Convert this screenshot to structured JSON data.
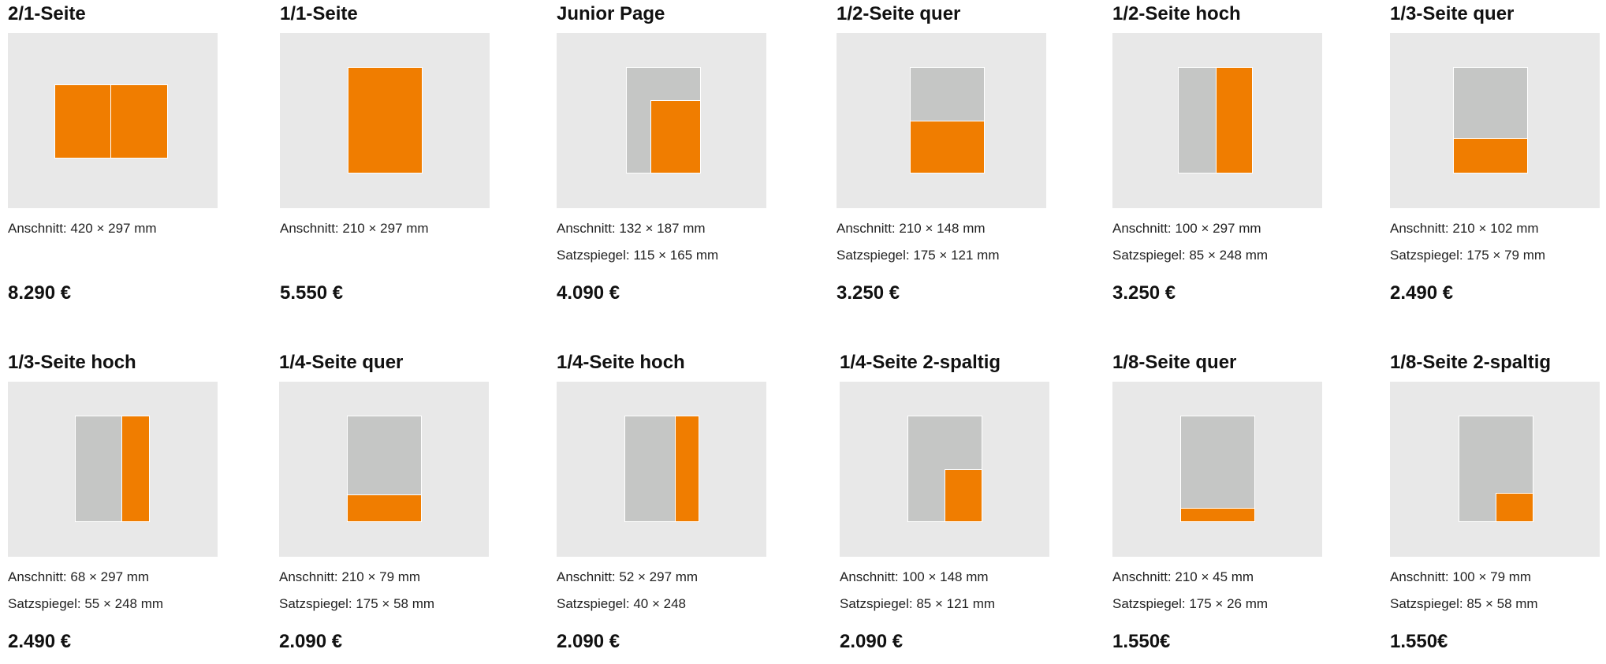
{
  "colors": {
    "ad": "#f07d00",
    "page": "#c5c6c5",
    "thumb_bg": "#e8e8e8"
  },
  "items": [
    {
      "title": "2/1-Seite",
      "anschnitt": "Anschnitt: 420 × 297 mm",
      "satzspiegel": "",
      "price": "8.290 €"
    },
    {
      "title": "1/1-Seite",
      "anschnitt": "Anschnitt: 210 × 297 mm",
      "satzspiegel": "",
      "price": "5.550 €"
    },
    {
      "title": "Junior Page",
      "anschnitt": "Anschnitt: 132 × 187 mm",
      "satzspiegel": "Satzspiegel: 115 × 165 mm",
      "price": "4.090 €"
    },
    {
      "title": "1/2-Seite quer",
      "anschnitt": "Anschnitt: 210 × 148 mm",
      "satzspiegel": "Satzspiegel: 175 × 121 mm",
      "price": "3.250 €"
    },
    {
      "title": "1/2-Seite hoch",
      "anschnitt": "Anschnitt: 100 × 297 mm",
      "satzspiegel": "Satzspiegel: 85 × 248 mm",
      "price": "3.250 €"
    },
    {
      "title": "1/3-Seite quer",
      "anschnitt": "Anschnitt: 210 × 102 mm",
      "satzspiegel": "Satzspiegel: 175 × 79 mm",
      "price": "2.490 €"
    },
    {
      "title": "1/3-Seite hoch",
      "anschnitt": "Anschnitt: 68 × 297 mm",
      "satzspiegel": "Satzspiegel: 55 × 248 mm",
      "price": "2.490 €"
    },
    {
      "title": "1/4-Seite quer",
      "anschnitt": "Anschnitt: 210 × 79 mm",
      "satzspiegel": "Satzspiegel: 175 × 58 mm",
      "price": "2.090 €"
    },
    {
      "title": "1/4-Seite hoch",
      "anschnitt": "Anschnitt: 52 × 297 mm",
      "satzspiegel": "Satzspiegel: 40 × 248",
      "price": "2.090 €"
    },
    {
      "title": "1/4-Seite 2-spaltig",
      "anschnitt": "Anschnitt: 100 × 148 mm",
      "satzspiegel": "Satzspiegel: 85 × 121 mm",
      "price": "2.090 €"
    },
    {
      "title": "1/8-Seite quer",
      "anschnitt": "Anschnitt: 210 × 45 mm",
      "satzspiegel": "Satzspiegel: 175 × 26 mm",
      "price": "1.550€"
    },
    {
      "title": "1/8-Seite 2-spaltig",
      "anschnitt": "Anschnitt: 100 × 79 mm",
      "satzspiegel": "Satzspiegel: 85 × 58 mm",
      "price": "1.550€"
    }
  ]
}
